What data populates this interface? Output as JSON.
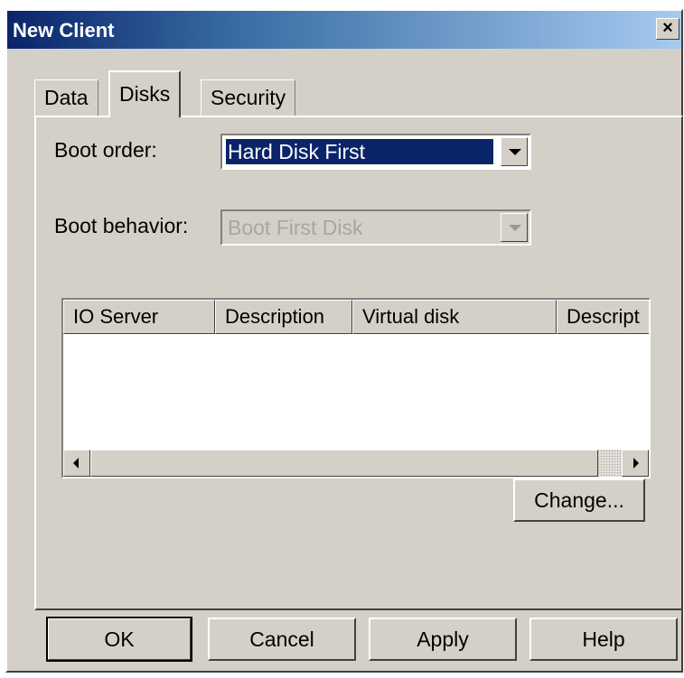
{
  "window": {
    "title": "New Client",
    "close_label": "×"
  },
  "tabs": [
    {
      "label": "Data",
      "active": false
    },
    {
      "label": "Disks",
      "active": true
    },
    {
      "label": "Security",
      "active": false
    }
  ],
  "disks_tab": {
    "boot_order": {
      "label": "Boot order:",
      "value": "Hard Disk First"
    },
    "boot_behavior": {
      "label": "Boot behavior:",
      "value": "Boot First Disk",
      "disabled": true
    },
    "list": {
      "columns": [
        "IO Server",
        "Description",
        "Virtual disk",
        "Descript"
      ],
      "rows": []
    },
    "change_button": "Change..."
  },
  "footer": {
    "ok": "OK",
    "cancel": "Cancel",
    "apply": "Apply",
    "help": "Help"
  },
  "colors": {
    "title_active": "#0a246a",
    "face": "#d4d0c8",
    "selection": "#0a246a"
  }
}
